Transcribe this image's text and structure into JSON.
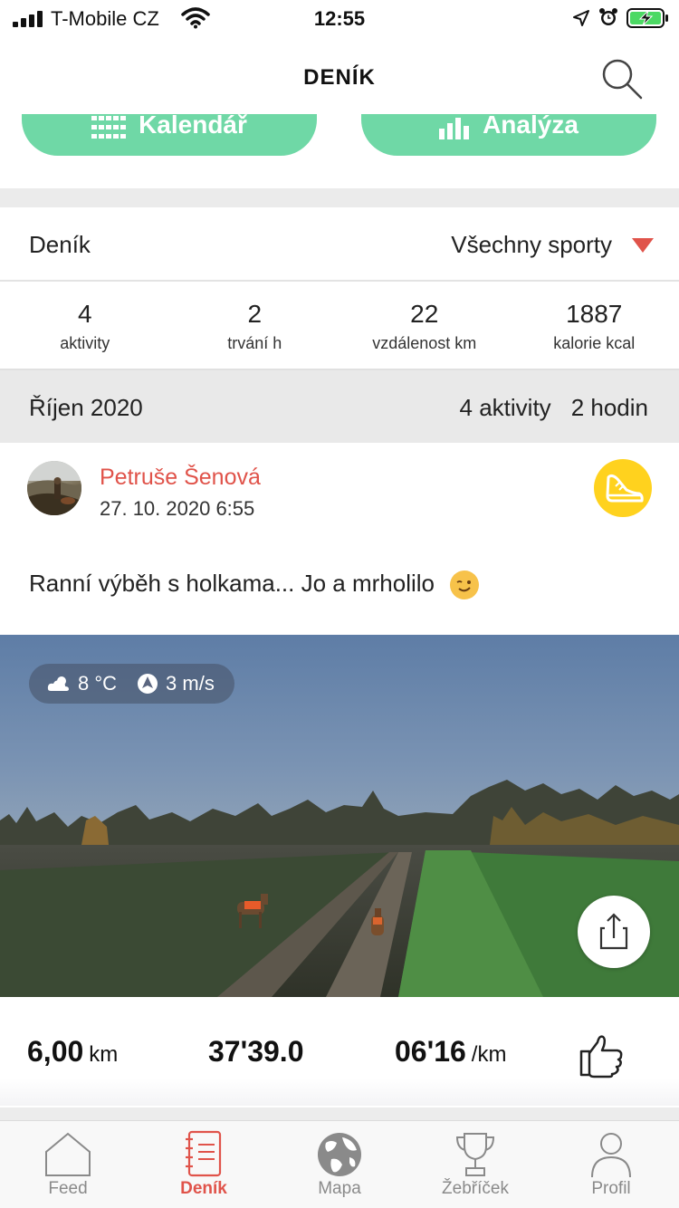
{
  "status_bar": {
    "carrier": "T-Mobile CZ",
    "time": "12:55"
  },
  "header": {
    "title": "DENÍK"
  },
  "quick_buttons": {
    "calendar_label": "Kalendář",
    "analysis_label": "Analýza"
  },
  "filter": {
    "label": "Deník",
    "selected_sport": "Všechny sporty"
  },
  "stats": [
    {
      "value": "4",
      "label": "aktivity"
    },
    {
      "value": "2",
      "label": "trvání h"
    },
    {
      "value": "22",
      "label": "vzdálenost km"
    },
    {
      "value": "1887",
      "label": "kalorie kcal"
    }
  ],
  "month": {
    "label": "Říjen 2020",
    "activities": "4 aktivity",
    "hours": "2 hodin"
  },
  "activity": {
    "user_name": "Petruše Šenová",
    "date": "27. 10. 2020 6:55",
    "text": "Ranní výběh s holkama... Jo a mrholilo",
    "sport_icon": "running-shoe-icon",
    "weather": {
      "temperature": "8 °C",
      "wind": "3 m/s"
    },
    "metrics": {
      "distance_value": "6,00",
      "distance_unit": "km",
      "duration": "37'39.0",
      "pace_value": "06'16",
      "pace_unit": "/km"
    }
  },
  "tabbar": {
    "tabs": [
      {
        "label": "Feed",
        "icon": "home-icon"
      },
      {
        "label": "Deník",
        "icon": "notebook-icon"
      },
      {
        "label": "Mapa",
        "icon": "globe-icon"
      },
      {
        "label": "Žebříček",
        "icon": "trophy-icon"
      },
      {
        "label": "Profil",
        "icon": "person-icon"
      }
    ],
    "active_index": 1
  },
  "colors": {
    "accent_green": "#6fd8a6",
    "accent_red": "#e0534a",
    "badge_yellow": "#ffd21e"
  }
}
